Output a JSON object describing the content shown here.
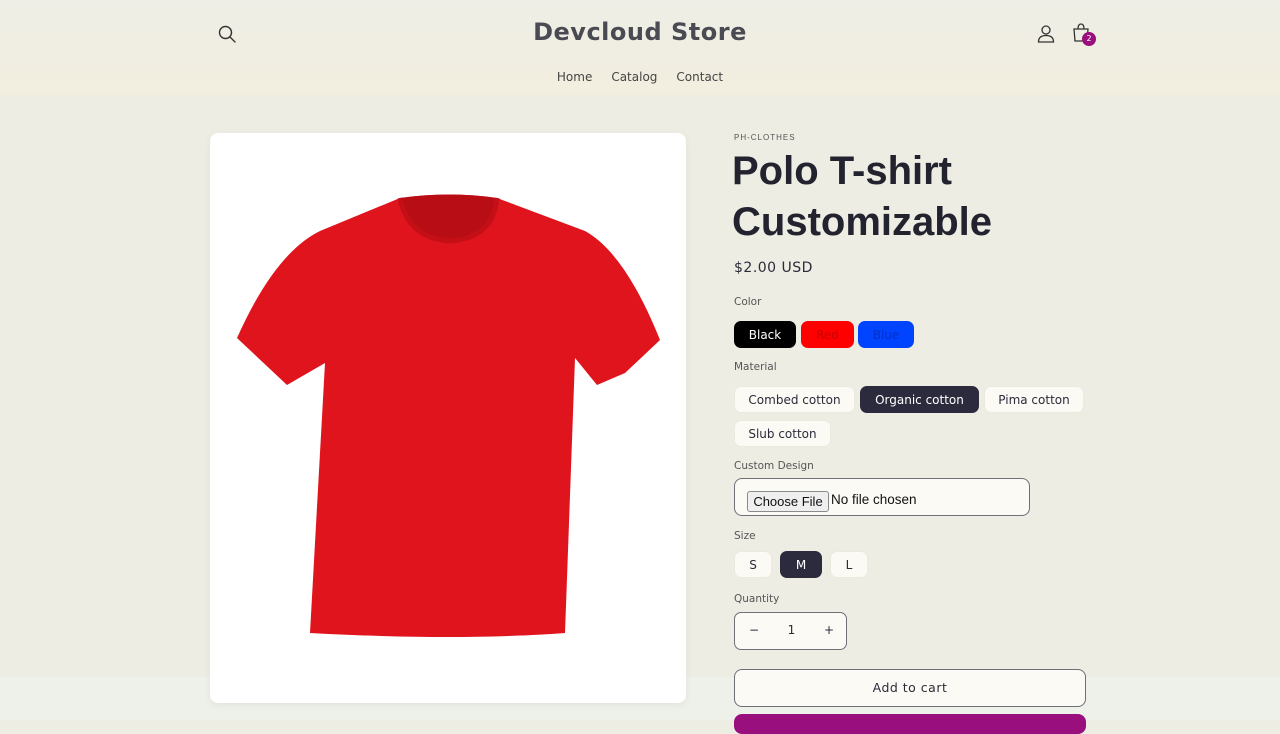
{
  "header": {
    "store_name": "Devcloud Store",
    "cart_count": "2",
    "nav": [
      "Home",
      "Catalog",
      "Contact"
    ]
  },
  "product": {
    "vendor": "PH-CLOTHES",
    "title": "Polo T-shirt Customizable",
    "price": "$2.00 USD",
    "image_color": "#e0141c",
    "color": {
      "label": "Color",
      "options": [
        {
          "label": "Black",
          "bg": "#000000",
          "fg": "#ffffff"
        },
        {
          "label": "Red",
          "bg": "#ff0000",
          "fg": "#c80000"
        },
        {
          "label": "Blue",
          "bg": "#0044ff",
          "fg": "#0030cc"
        }
      ]
    },
    "material": {
      "label": "Material",
      "options": [
        "Combed cotton",
        "Organic cotton",
        "Pima cotton",
        "Slub cotton"
      ],
      "selected": "Organic cotton"
    },
    "custom_design": {
      "label": "Custom Design",
      "button": "Choose File",
      "status": "No file chosen"
    },
    "size": {
      "label": "Size",
      "options": [
        "S",
        "M",
        "L"
      ],
      "selected": "M"
    },
    "quantity": {
      "label": "Quantity",
      "minus": "−",
      "value": "1",
      "plus": "+"
    },
    "add_to_cart": "Add to cart",
    "buy_now_color": "#9a0f7e"
  }
}
